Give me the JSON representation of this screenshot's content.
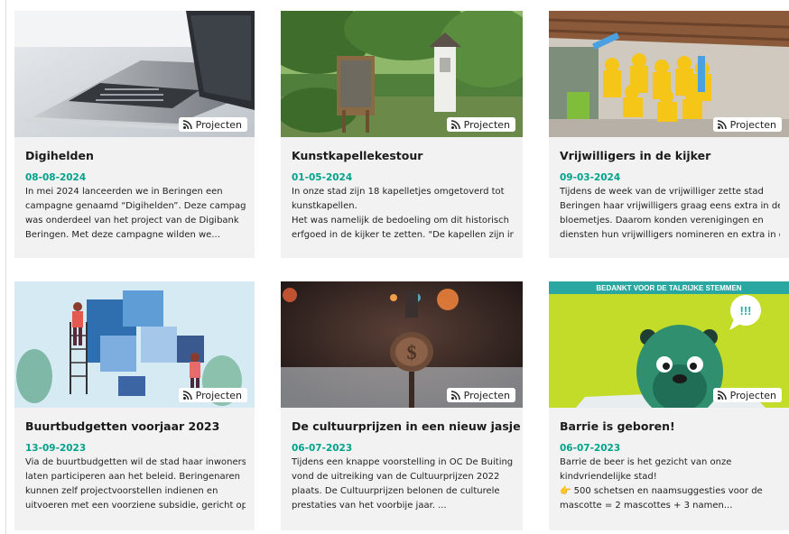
{
  "cards": [
    {
      "title": "Digihelden",
      "date": "08-08-2024",
      "badge": "Projecten",
      "badge_icon": "rss-icon",
      "image": "laptop keyboard photo",
      "lines": [
        "In mei 2024 lanceerden we in Beringen een",
        "campagne genaamd “Digihelden”. Deze campagne",
        "was onderdeel van het project van de Digibank",
        "Beringen. Met deze campagne wilden we..."
      ]
    },
    {
      "title": "Kunstkapellekestour",
      "date": "01-05-2024",
      "badge": "Projecten",
      "badge_icon": "rss-icon",
      "image": "chapel in garden photo",
      "lines": [
        "In onze stad zijn 18 kapelletjes omgetoverd tot",
        "kunstkapellen.",
        "Het was namelijk de bedoeling om dit historisch",
        "erfgoed in de kijker te zetten. \"De kapellen zijn in..."
      ]
    },
    {
      "title": "Vrijwilligers in de kijker",
      "date": "09-03-2024",
      "badge": "Projecten",
      "badge_icon": "rss-icon",
      "image": "volunteers group photo",
      "lines": [
        "Tijdens de week van de vrijwilliger zette stad",
        "Beringen haar vrijwilligers graag eens extra in de",
        "bloemetjes. Daarom konden verenigingen en",
        "diensten hun vrijwilligers nomineren en extra in d..."
      ]
    },
    {
      "title": "Buurtbudgetten voorjaar 2023",
      "date": "13-09-2023",
      "badge": "Projecten",
      "badge_icon": "rss-icon",
      "image": "puzzle lightbulb illustration",
      "lines": [
        "Via de buurtbudgetten wil de stad haar inwoners",
        "laten participeren aan het beleid. Beringenaren",
        "kunnen zelf projectvoorstellen indienen en",
        "uitvoeren met een voorziene subsidie, gericht op..."
      ]
    },
    {
      "title": "De cultuurprijzen in een nieuw jasje",
      "date": "06-07-2023",
      "badge": "Projecten",
      "badge_icon": "rss-icon",
      "image": "trophy photo",
      "lines": [
        "Tijdens een knappe voorstelling in OC De Buiting",
        "vond de uitreiking van de Cultuurprijzen 2022",
        "plaats. De Cultuurprijzen belonen de culturele",
        "prestaties van het voorbije jaar. ..."
      ]
    },
    {
      "title": "Barrie is geboren!",
      "date": "06-07-2023",
      "badge": "Projecten",
      "badge_icon": "rss-icon",
      "image": "bear mascot illustration",
      "image_text": "BEDANKT VOOR DE TALRIJKE STEMMEN",
      "image_bubble": "!!!",
      "lines": [
        "Barrie de beer is het gezicht van onze",
        "kindvriendelijke stad!",
        "👉 500 schetsen en naamsuggesties voor de",
        "mascotte = 2 mascottes + 3 namen..."
      ]
    }
  ],
  "colors": {
    "card_bg": "#f2f2f2",
    "date": "#00a38a",
    "title": "#1b1b1b",
    "text": "#222222",
    "badge_bg": "#ffffff"
  }
}
